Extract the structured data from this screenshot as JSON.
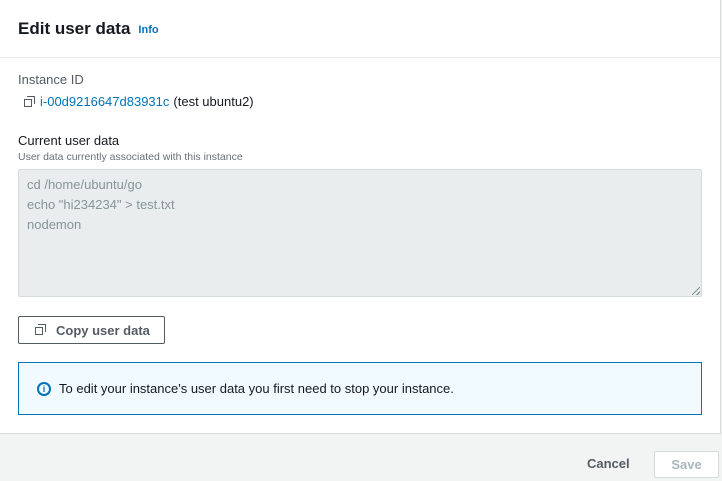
{
  "panel": {
    "title": "Edit user data",
    "info_label": "Info"
  },
  "instance": {
    "label": "Instance ID",
    "copy_icon": "copy-icon",
    "id": "i-00d9216647d83931c",
    "name": "(test ubuntu2)"
  },
  "current_user_data": {
    "label": "Current user data",
    "description": "User data currently associated with this instance",
    "value": "cd /home/ubuntu/go\necho \"hi234234\" > test.txt\nnodemon"
  },
  "copy_button": {
    "label": "Copy user data",
    "icon": "copy-icon"
  },
  "alert": {
    "icon": "info-circle-icon",
    "message": "To edit your instance's user data you first need to stop your instance."
  },
  "footer": {
    "cancel_label": "Cancel",
    "save_label": "Save"
  },
  "colors": {
    "link": "#0073bb",
    "alert_bg": "#f1faff",
    "alert_border": "#0073bb",
    "disabled_text": "#aab7b8"
  }
}
